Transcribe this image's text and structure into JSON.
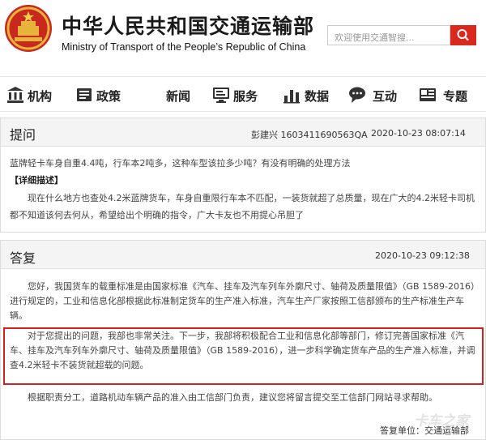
{
  "header": {
    "title_cn": "中华人民共和国交通运输部",
    "title_en": "Ministry of Transport of the People’s Republic of China",
    "search_placeholder": "欢迎使用交通智搜...",
    "accent_color": "#d9281c"
  },
  "nav": [
    {
      "label": "机构",
      "icon": "building-icon"
    },
    {
      "label": "政策",
      "icon": "book-icon"
    },
    {
      "label": "新闻",
      "icon": ""
    },
    {
      "label": "服务",
      "icon": "monitor-icon"
    },
    {
      "label": "数据",
      "icon": "bar-chart-icon"
    },
    {
      "label": "互动",
      "icon": "chat-bubble-icon"
    },
    {
      "label": "专题",
      "icon": "topic-icon"
    }
  ],
  "question": {
    "heading": "提问",
    "author_id": "彭建兴 1603411690563QA",
    "time": "2020-10-23 08:07:14",
    "summary": "蓝牌轻卡车身自重4.4吨，行车本2吨多，这种车型该拉多少吨？有没有明确的处理方法",
    "detail_label": "【详细描述】",
    "detail": "现在什么地方也查处4.2米蓝牌货车，车身自重限行车本不匹配，一装货就超了总质量，现在广大的4.2米轻卡司机都不知道该何去何从，希望给出个明确的指令，广大卡友也不用提心吊胆了"
  },
  "answer": {
    "heading": "答复",
    "time": "2020-10-23 09:12:38",
    "p1": "您好，我国货车的载重标准是由国家标准《汽车、挂车及汽车列车外廓尺寸、轴荷及质量限值》（GB 1589-2016）进行规定的，工业和信息化部根据此标准制定货车的生产准入标准，汽车生产厂家按照工信部颁布的生产标准生产车辆。",
    "p2": "对于您提出的问题，我部也非常关注。下一步，我部将积极配合工业和信息化部等部门，修订完善国家标准《汽车、挂车及汽车列车外廓尺寸、轴荷及质量限值》（GB 1589-2016），进一步科学确定货车产品的生产准入标准，并调查4.2米轻卡不装货就超载的问题。",
    "p3": "根据职责分工，道路机动车辆产品的准入由工信部门负责，建议您将留言提交至工信部门网站寻求帮助。",
    "signature": "答复单位：交通运输部",
    "watermark": "卡车之家",
    "highlight_color": "#d42020"
  }
}
